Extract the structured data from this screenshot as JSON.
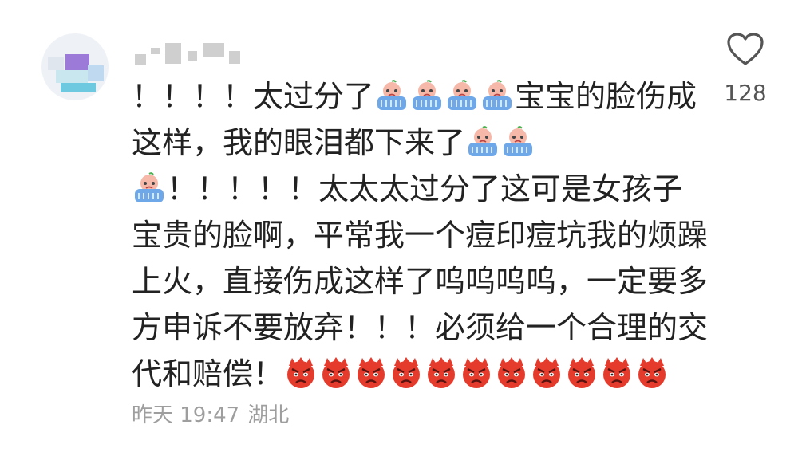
{
  "comment": {
    "segments": [
      [
        "t:！！！！太过分了",
        "e:crying-face-emoji",
        "e:crying-face-emoji",
        "e:crying-face-emoji",
        "e:crying-face-emoji",
        "t:宝宝的脸伤成"
      ],
      [
        "t:这样，我的眼泪都下来了",
        "e:crying-face-emoji",
        "e:crying-face-emoji"
      ],
      [
        "e:crying-face-emoji",
        "t:！！！！！太太太过分了这可是女孩子"
      ],
      [
        "t:宝贵的脸啊，平常我一个痘印痘坑我的烦躁"
      ],
      [
        "t:上火，直接伤成这样了呜呜呜呜，一定要多"
      ],
      [
        "t:方申诉不要放弃！！！必须给一个合理的交"
      ],
      [
        "t:代和赔偿！",
        "e:angry-face-emoji",
        "e:angry-face-emoji",
        "e:angry-face-emoji",
        "e:angry-face-emoji",
        "e:angry-face-emoji",
        "e:angry-face-emoji",
        "e:angry-face-emoji",
        "e:angry-face-emoji",
        "e:angry-face-emoji",
        "e:angry-face-emoji",
        "e:angry-face-emoji"
      ]
    ]
  },
  "meta": {
    "time": "昨天 19:47",
    "location": "湖北"
  },
  "like": {
    "count": "128",
    "icon": "heart-outline-icon"
  },
  "colors": {
    "text": "#222222",
    "meta": "#9e9e9e",
    "like_count": "#555555",
    "angry_emoji": "#e53b2c",
    "crying_emoji_tub": "#6fa8e8"
  }
}
